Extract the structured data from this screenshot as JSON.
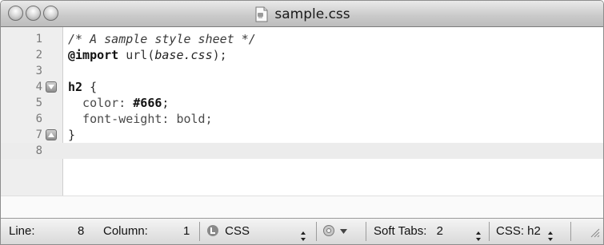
{
  "window": {
    "title": "sample.css"
  },
  "editor": {
    "lines": [
      {
        "number": "1",
        "fold": "",
        "tokens": [
          {
            "type": "comment",
            "text": "/* A sample style sheet */"
          }
        ]
      },
      {
        "number": "2",
        "fold": "",
        "tokens": [
          {
            "type": "at",
            "text": "@import"
          },
          {
            "type": "url",
            "text": " url("
          },
          {
            "type": "arg",
            "text": "base.css"
          },
          {
            "type": "url",
            "text": ");"
          }
        ]
      },
      {
        "number": "3",
        "fold": "",
        "tokens": []
      },
      {
        "number": "4",
        "fold": "collapse",
        "tokens": [
          {
            "type": "sel",
            "text": "h2"
          },
          {
            "type": "plain",
            "text": " {"
          }
        ]
      },
      {
        "number": "5",
        "fold": "",
        "tokens": [
          {
            "type": "prop",
            "text": "  color: "
          },
          {
            "type": "val",
            "text": "#666"
          },
          {
            "type": "plain",
            "text": ";"
          }
        ]
      },
      {
        "number": "6",
        "fold": "",
        "tokens": [
          {
            "type": "prop",
            "text": "  font-weight: bold;"
          }
        ]
      },
      {
        "number": "7",
        "fold": "expand",
        "tokens": [
          {
            "type": "plain",
            "text": "}"
          }
        ]
      },
      {
        "number": "8",
        "fold": "",
        "tokens": [],
        "current": true
      }
    ]
  },
  "statusbar": {
    "line_label": "Line:",
    "line_value": "8",
    "column_label": "Column:",
    "column_value": "1",
    "language": "CSS",
    "soft_tabs_label": "Soft Tabs:",
    "soft_tabs_value": "2",
    "symbol": "CSS: h2"
  }
}
